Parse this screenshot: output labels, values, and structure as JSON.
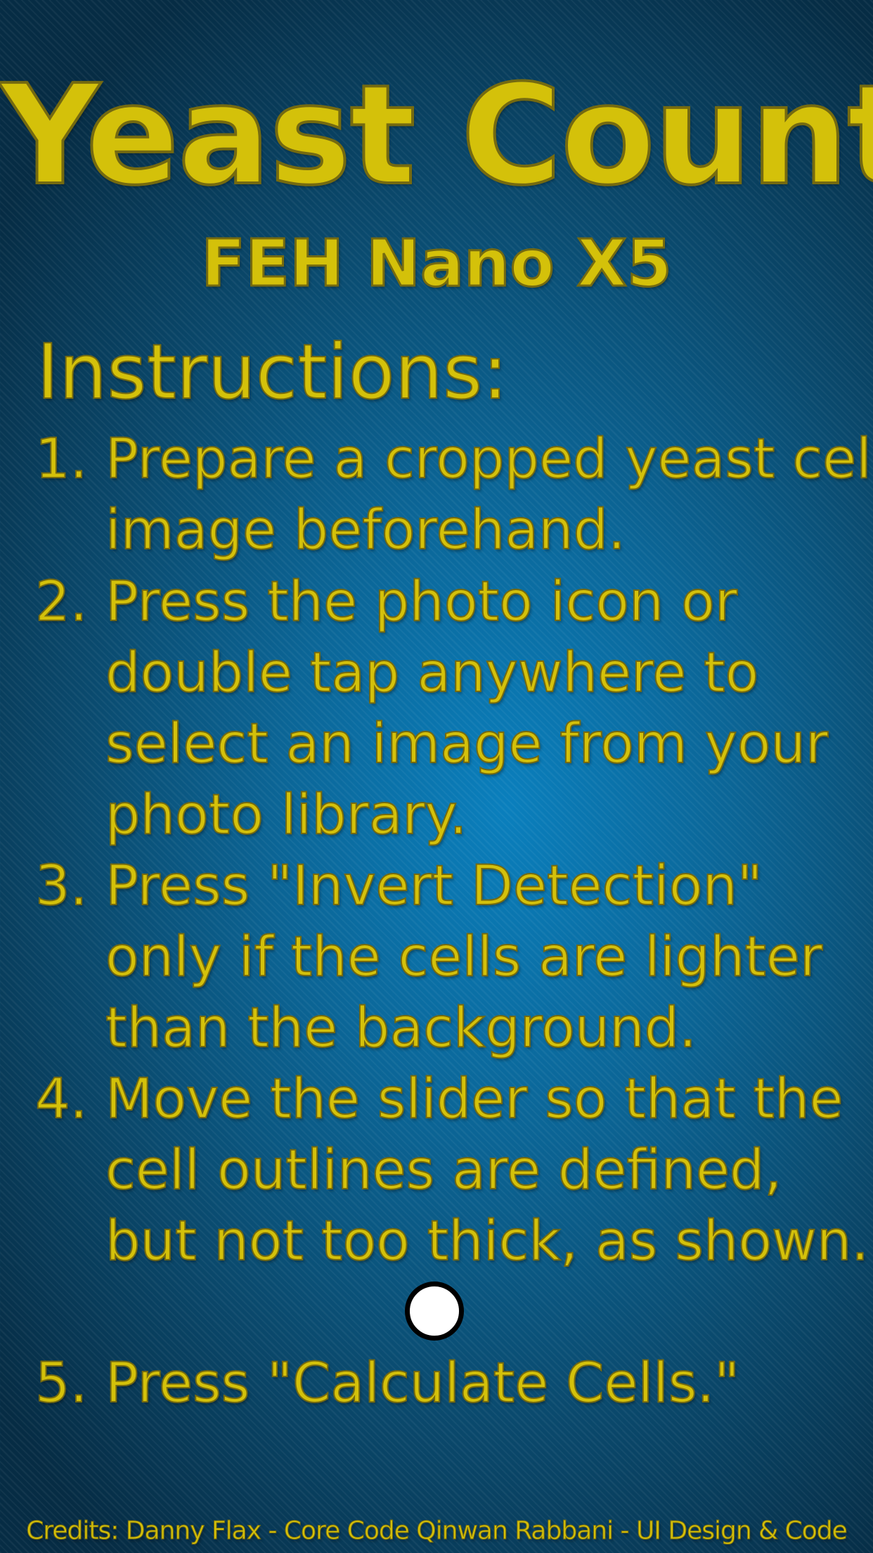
{
  "header": {
    "title": "Yeast Count",
    "subtitle": "FEH Nano X5"
  },
  "instructions": {
    "heading": "Instructions:",
    "steps": [
      {
        "number": "1.",
        "lines": [
          "Prepare a cropped yeast cell",
          "image beforehand."
        ]
      },
      {
        "number": "2.",
        "lines": [
          "Press the photo icon or",
          "double tap anywhere to",
          "select an image from your",
          "photo library."
        ]
      },
      {
        "number": "3.",
        "lines": [
          "Press \"Invert Detection\"",
          "only if the cells are lighter",
          "than the background."
        ]
      },
      {
        "number": "4.",
        "lines": [
          "Move the slider so that the",
          "cell outlines are defined,",
          "but not too thick, as shown."
        ]
      },
      {
        "number": "5.",
        "lines": [
          "Press \"Calculate Cells.\""
        ]
      }
    ]
  },
  "slider_thumb": {
    "icon": "circle-slider-thumb"
  },
  "footer": {
    "credits": "Credits: Danny Flax - Core Code Qinwan Rabbani - UI Design & Code"
  },
  "colors": {
    "text_gold": "#d4c10a",
    "text_outline": "#756a10",
    "background_center": "#0a7fbd",
    "background_edge": "#062c44"
  }
}
